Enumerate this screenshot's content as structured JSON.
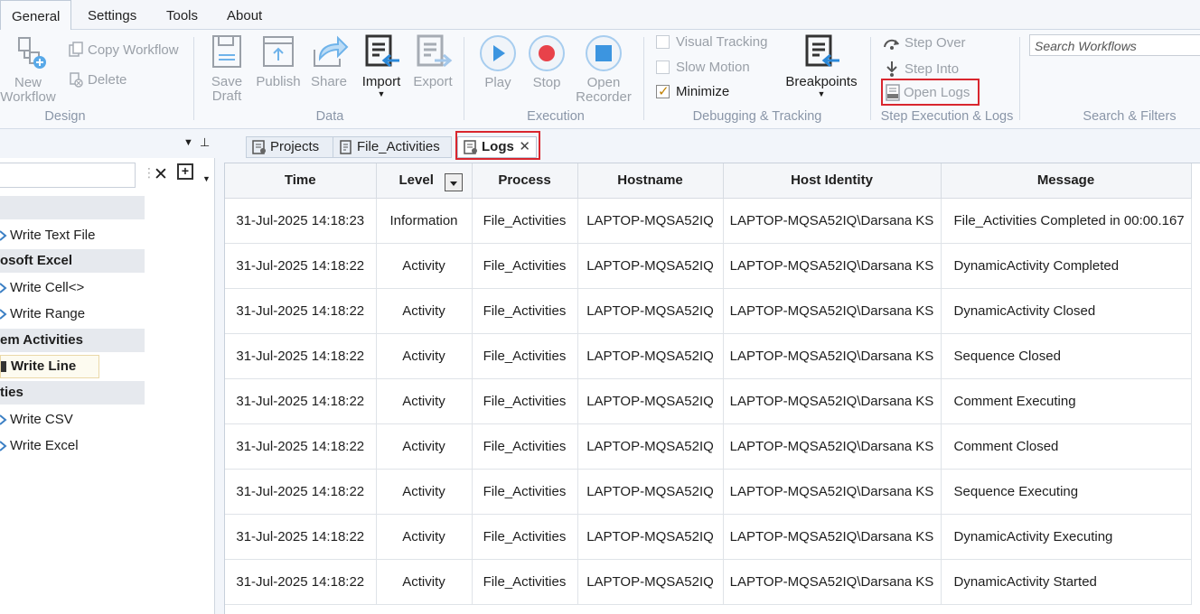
{
  "menu": {
    "tabs": [
      "General",
      "Settings",
      "Tools",
      "About"
    ],
    "active": "General"
  },
  "ribbon": {
    "design": {
      "new_workflow": "New Workflow",
      "copy_workflow": "Copy Workflow",
      "delete": "Delete",
      "group": "Design"
    },
    "data": {
      "save_draft": "Save Draft",
      "publish": "Publish",
      "share": "Share",
      "import": "Import",
      "export": "Export",
      "group": "Data"
    },
    "execution": {
      "play": "Play",
      "stop": "Stop",
      "open_recorder": "Open Recorder",
      "group": "Execution"
    },
    "debugging": {
      "visual_tracking": "Visual Tracking",
      "slow_motion": "Slow Motion",
      "minimize": "Minimize",
      "minimize_checked": true,
      "breakpoints": "Breakpoints",
      "group": "Debugging & Tracking"
    },
    "step": {
      "step_over": "Step Over",
      "step_into": "Step Into",
      "open_logs": "Open Logs",
      "group": "Step Execution & Logs"
    },
    "search": {
      "placeholder": "Search Workflows",
      "group": "Search & Filters"
    }
  },
  "left_panel": {
    "categories": [
      "osoft Excel",
      "em Activities",
      "ties"
    ],
    "items": [
      "Write Text File",
      "Write Cell<>",
      "Write Range",
      "Write Line",
      "Write CSV",
      "Write Excel"
    ]
  },
  "doc_tabs": {
    "projects": "Projects",
    "file_activities": "File_Activities",
    "logs": "Logs"
  },
  "log_table": {
    "columns": [
      "Time",
      "Level",
      "Process",
      "Hostname",
      "Host Identity",
      "Message"
    ],
    "rows": [
      [
        "31-Jul-2025 14:18:23",
        "Information",
        "File_Activities",
        "LAPTOP-MQSA52IQ",
        "LAPTOP-MQSA52IQ\\Darsana KS",
        "File_Activities Completed in 00:00.167"
      ],
      [
        "31-Jul-2025 14:18:22",
        "Activity",
        "File_Activities",
        "LAPTOP-MQSA52IQ",
        "LAPTOP-MQSA52IQ\\Darsana KS",
        "DynamicActivity Completed"
      ],
      [
        "31-Jul-2025 14:18:22",
        "Activity",
        "File_Activities",
        "LAPTOP-MQSA52IQ",
        "LAPTOP-MQSA52IQ\\Darsana KS",
        "DynamicActivity Closed"
      ],
      [
        "31-Jul-2025 14:18:22",
        "Activity",
        "File_Activities",
        "LAPTOP-MQSA52IQ",
        "LAPTOP-MQSA52IQ\\Darsana KS",
        "Sequence Closed"
      ],
      [
        "31-Jul-2025 14:18:22",
        "Activity",
        "File_Activities",
        "LAPTOP-MQSA52IQ",
        "LAPTOP-MQSA52IQ\\Darsana KS",
        "Comment Executing"
      ],
      [
        "31-Jul-2025 14:18:22",
        "Activity",
        "File_Activities",
        "LAPTOP-MQSA52IQ",
        "LAPTOP-MQSA52IQ\\Darsana KS",
        "Comment Closed"
      ],
      [
        "31-Jul-2025 14:18:22",
        "Activity",
        "File_Activities",
        "LAPTOP-MQSA52IQ",
        "LAPTOP-MQSA52IQ\\Darsana KS",
        "Sequence Executing"
      ],
      [
        "31-Jul-2025 14:18:22",
        "Activity",
        "File_Activities",
        "LAPTOP-MQSA52IQ",
        "LAPTOP-MQSA52IQ\\Darsana KS",
        "DynamicActivity Executing"
      ],
      [
        "31-Jul-2025 14:18:22",
        "Activity",
        "File_Activities",
        "LAPTOP-MQSA52IQ",
        "LAPTOP-MQSA52IQ\\Darsana KS",
        "DynamicActivity Started"
      ]
    ]
  },
  "colors": {
    "accent_blue": "#2b88d8",
    "highlight_red": "#d9262e",
    "stop_red": "#e8424a"
  }
}
